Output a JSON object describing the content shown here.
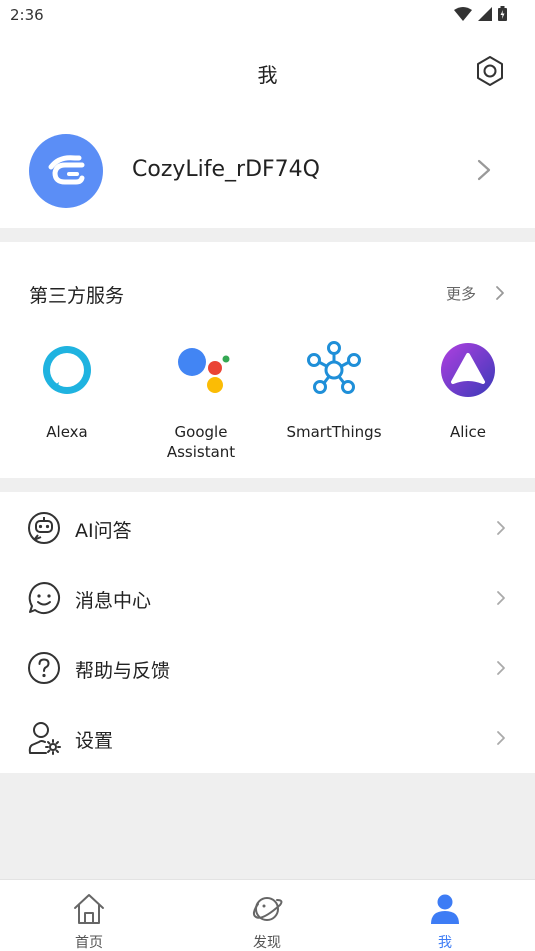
{
  "status_bar": {
    "time": "2:36"
  },
  "header": {
    "title": "我"
  },
  "profile": {
    "name": "CozyLife_rDF74Q"
  },
  "third_party": {
    "title": "第三方服务",
    "more_label": "更多",
    "services": [
      {
        "label": "Alexa",
        "icon": "alexa-icon"
      },
      {
        "label_line1": "Google",
        "label_line2": "Assistant",
        "icon": "google-assistant-icon"
      },
      {
        "label": "SmartThings",
        "icon": "smartthings-icon"
      },
      {
        "label": "Alice",
        "icon": "alice-icon"
      }
    ]
  },
  "menu": {
    "items": [
      {
        "label": "AI问答",
        "icon": "robot-icon"
      },
      {
        "label": "消息中心",
        "icon": "message-icon"
      },
      {
        "label": "帮助与反馈",
        "icon": "help-icon"
      },
      {
        "label": "设置",
        "icon": "user-settings-icon"
      }
    ]
  },
  "tabbar": {
    "tabs": [
      {
        "label": "首页",
        "icon": "home-icon"
      },
      {
        "label": "发现",
        "icon": "planet-icon"
      },
      {
        "label": "我",
        "icon": "person-icon",
        "active": true
      }
    ]
  },
  "colors": {
    "accent": "#3d7cf5",
    "avatar": "#5b8ef6",
    "background": "#efefef"
  }
}
